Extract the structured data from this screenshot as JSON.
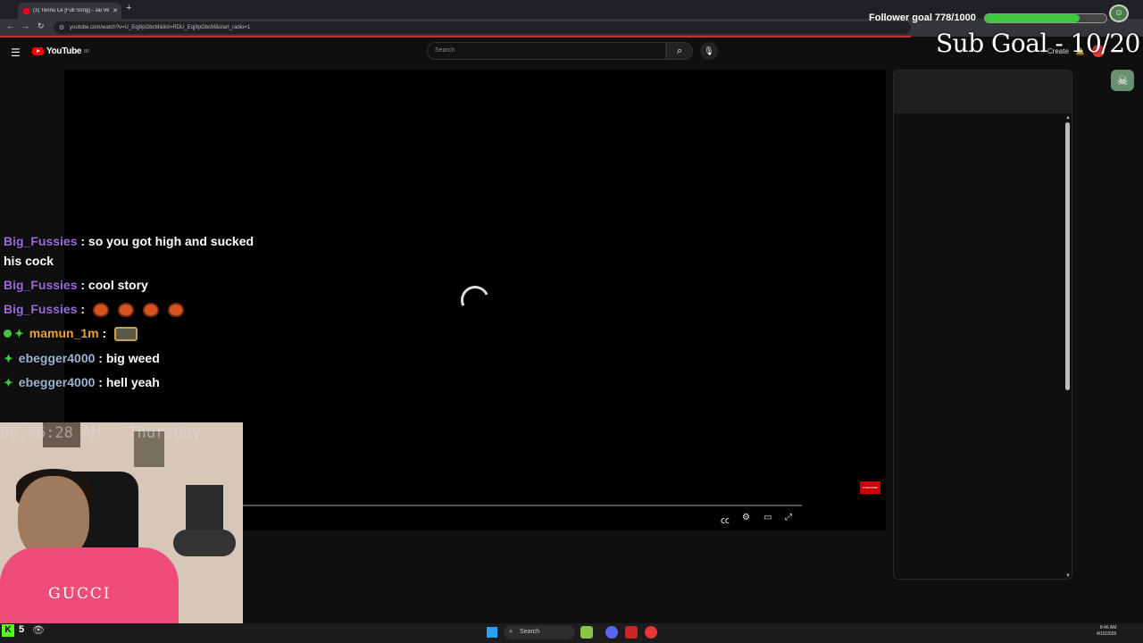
{
  "browser": {
    "tab_title": "(3) Tennu Le [Full Song] - Jai Ve",
    "tab_close": "✕",
    "new_tab": "+",
    "url": "youtube.com/watch?v=U_Eqj9pGbcM&list=RDU_Eqj9pGbcM&start_radio=1",
    "back": "←",
    "forward": "→",
    "reload": "↻"
  },
  "youtube": {
    "logo_text": "YouTube",
    "logo_sup": "80",
    "search_placeholder": "Search",
    "create_label": "+ Create"
  },
  "overlays": {
    "follower_goal_label": "Follower goal 778/1000",
    "follower_current": 778,
    "follower_target": 1000,
    "sub_goal_label": "Sub Goal - 10/20",
    "clock_text": "08:46:28 AM - Thursday"
  },
  "chat": [
    {
      "user": "Big_Fussies",
      "text": ": so you got high and sucked",
      "cont": "his cock"
    },
    {
      "user": "Big_Fussies",
      "text": ": cool story"
    },
    {
      "user": "Big_Fussies",
      "text": ":"
    },
    {
      "user": "mamun_1m",
      "text": ":"
    },
    {
      "user": "ebegger4000",
      "text": ": big weed"
    },
    {
      "user": "ebegger4000",
      "text": ": hell yeah"
    }
  ],
  "webcam": {
    "shirt_text": "GUCCI"
  },
  "stream": {
    "viewer_count": "5",
    "kick_logo": "K"
  },
  "taskbar": {
    "search_label": "Search",
    "time": "8:46 AM",
    "date": "4/16/2026"
  },
  "colors": {
    "chat_user_purple": "#9a6bd8",
    "chat_user_orange": "#e8a03a",
    "chat_user_blue": "#9bb4d2",
    "follower_bar": "#3ec93e",
    "youtube_red": "#ff0000"
  }
}
